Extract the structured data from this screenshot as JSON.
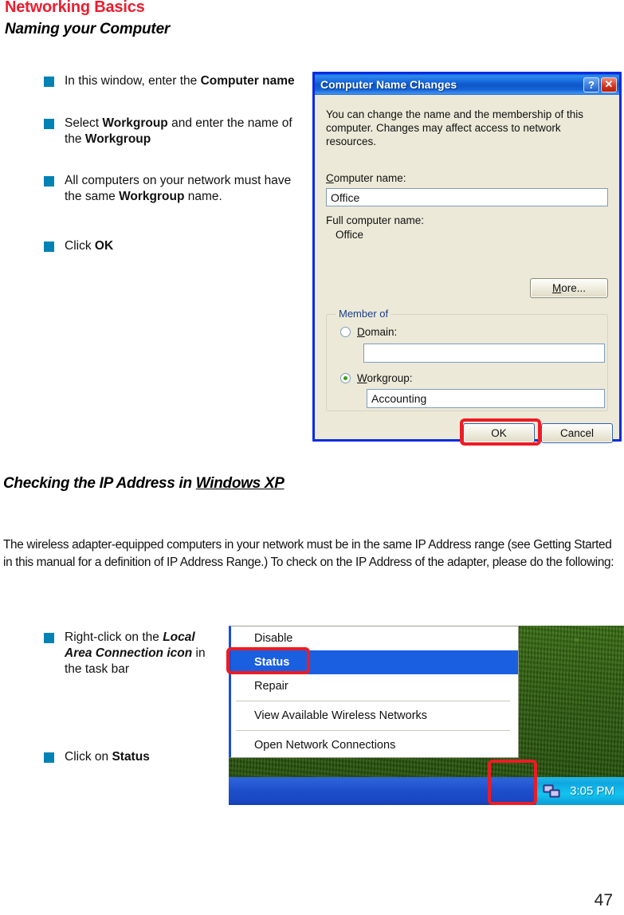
{
  "page": {
    "header_main": "Networking Basics",
    "header_sub": "Naming your Computer",
    "page_number": "47"
  },
  "instructions_top": {
    "items": [
      {
        "id": "enter-computer-name",
        "parts": [
          {
            "text": "In this window, enter the ",
            "style": "normal"
          },
          {
            "text": "Computer name",
            "style": "bold"
          }
        ]
      },
      {
        "id": "select-workgroup",
        "parts": [
          {
            "text": "Select ",
            "style": "normal"
          },
          {
            "text": "Workgroup",
            "style": "bold"
          },
          {
            "text": " and enter the name of the ",
            "style": "normal"
          },
          {
            "text": "Workgroup",
            "style": "bold"
          }
        ]
      },
      {
        "id": "same-workgroup-name",
        "parts": [
          {
            "text": "All computers on your network must have the same ",
            "style": "normal"
          },
          {
            "text": "Workgroup",
            "style": "bold"
          },
          {
            "text": " name.",
            "style": "normal"
          }
        ]
      },
      {
        "id": "click-ok",
        "parts": [
          {
            "text": "Click ",
            "style": "normal"
          },
          {
            "text": "OK",
            "style": "bold"
          }
        ]
      }
    ]
  },
  "dialog": {
    "title": "Computer Name Changes",
    "help_button": "?",
    "close_button": "✕",
    "description": "You can change the name and the membership of this computer. Changes may affect access to network resources.",
    "computer_name_label": "Computer name:",
    "computer_name_value": "Office",
    "full_computer_name_label": "Full computer name:",
    "full_computer_name_value": "Office",
    "more_button": "More...",
    "member_of_label": "Member of",
    "domain_label": "Domain:",
    "domain_value": "",
    "domain_selected": false,
    "workgroup_label": "Workgroup:",
    "workgroup_value": "Accounting",
    "workgroup_selected": true,
    "ok_button": "OK",
    "cancel_button": "Cancel",
    "highlight_color": "#ED1C24"
  },
  "section": {
    "heading_plain": "Checking the IP Address in ",
    "heading_underlined": "Windows XP",
    "paragraph": "The wireless adapter-equipped computers in your network must be in the same IP Address range (see Getting Started in this manual for a definition of IP Address Range.)  To check on the IP Address of the adapter, please do the following:"
  },
  "instructions_bottom": {
    "items": [
      {
        "id": "right-click-lan-icon",
        "parts": [
          {
            "text": "Right-click on the ",
            "style": "normal"
          },
          {
            "text": "Local Area Connection icon",
            "style": "bolditalic"
          },
          {
            "text": " in the task bar",
            "style": "normal"
          }
        ]
      },
      {
        "id": "click-status",
        "parts": [
          {
            "text": "Click on ",
            "style": "normal"
          },
          {
            "text": "Status",
            "style": "bold"
          }
        ]
      }
    ]
  },
  "context_menu": {
    "items": [
      {
        "label": "Disable",
        "selected": false,
        "separator_after": false
      },
      {
        "label": "Status",
        "selected": true,
        "separator_after": false
      },
      {
        "label": "Repair",
        "selected": false,
        "separator_after": true
      },
      {
        "label": "View Available Wireless Networks",
        "selected": false,
        "separator_after": true
      },
      {
        "label": "Open Network Connections",
        "selected": false,
        "separator_after": false
      }
    ],
    "taskbar_time": "3:05 PM",
    "tray_icon": "network-connection-icon",
    "highlight_color": "#ED1C24"
  }
}
